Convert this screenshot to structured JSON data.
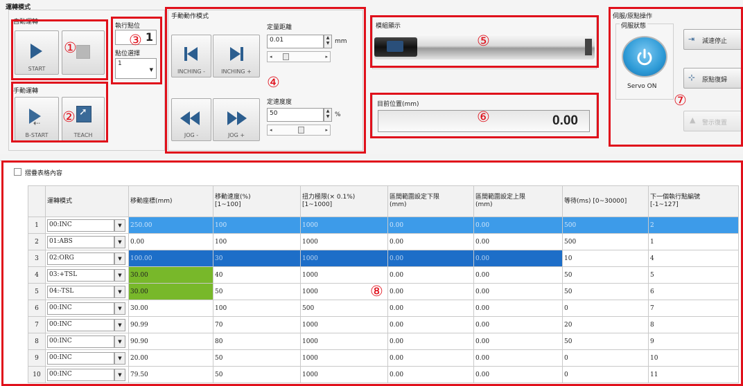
{
  "operation_mode": {
    "title": "運轉模式",
    "auto_title": "自動運轉",
    "start_label": "START",
    "manual_title": "手動運轉",
    "bstart_label": "B-START",
    "teach_label": "TEACH"
  },
  "exec_position": {
    "title": "執行點位",
    "value": "1",
    "select_label": "點位選擇",
    "select_value": "1"
  },
  "manual_motion": {
    "title": "手動動作模式",
    "distance_label": "定量距離",
    "distance_value": "0.01",
    "distance_unit": "mm",
    "speed_label": "定速度度",
    "speed_value": "50",
    "speed_unit": "%",
    "inching_minus": "INCHING -",
    "inching_plus": "INCHING +",
    "jog_minus": "JOG -",
    "jog_plus": "JOG +"
  },
  "model_display": {
    "title": "模組顯示"
  },
  "target_position": {
    "title": "目前位置(mm)",
    "value": "0.00"
  },
  "servo": {
    "title": "伺服/原點操作",
    "status_label": "伺服狀態",
    "servo_label": "Servo ON",
    "decel_stop": "減速停止",
    "home_return": "原點復歸",
    "alarm_reset": "警示復置",
    "accent": "#2d9ad6"
  },
  "table": {
    "fold_label": "摺疊表格內容",
    "headers": [
      "",
      "運轉模式",
      "移動座標(mm)",
      "移動速度(%)\n[1~100]",
      "扭力極限(× 0.1%)\n[1~1000]",
      "區間範圍設定下限\n(mm)",
      "區間範圍設定上限\n(mm)",
      "等待(ms) [0~30000]",
      "下一個執行點編號\n[-1~127]"
    ],
    "rows": [
      {
        "n": "1",
        "mode": "00:INC",
        "coord": "250.00",
        "speed": "100",
        "torque": "1000",
        "lo": "0.00",
        "hi": "0.00",
        "wait": "500",
        "next": "2"
      },
      {
        "n": "2",
        "mode": "01:ABS",
        "coord": "0.00",
        "speed": "100",
        "torque": "1000",
        "lo": "0.00",
        "hi": "0.00",
        "wait": "500",
        "next": "1"
      },
      {
        "n": "3",
        "mode": "02:ORG",
        "coord": "100.00",
        "speed": "30",
        "torque": "1000",
        "lo": "0.00",
        "hi": "0.00",
        "wait": "10",
        "next": "4"
      },
      {
        "n": "4",
        "mode": "03:+TSL",
        "coord": "30.00",
        "speed": "40",
        "torque": "1000",
        "lo": "0.00",
        "hi": "0.00",
        "wait": "50",
        "next": "5"
      },
      {
        "n": "5",
        "mode": "04:-TSL",
        "coord": "30.00",
        "speed": "50",
        "torque": "1000",
        "lo": "0.00",
        "hi": "0.00",
        "wait": "50",
        "next": "6"
      },
      {
        "n": "6",
        "mode": "00:INC",
        "coord": "30.00",
        "speed": "100",
        "torque": "500",
        "lo": "0.00",
        "hi": "0.00",
        "wait": "0",
        "next": "7"
      },
      {
        "n": "7",
        "mode": "00:INC",
        "coord": "90.99",
        "speed": "70",
        "torque": "1000",
        "lo": "0.00",
        "hi": "0.00",
        "wait": "20",
        "next": "8"
      },
      {
        "n": "8",
        "mode": "00:INC",
        "coord": "90.90",
        "speed": "80",
        "torque": "1000",
        "lo": "0.00",
        "hi": "0.00",
        "wait": "50",
        "next": "9"
      },
      {
        "n": "9",
        "mode": "00:INC",
        "coord": "20.00",
        "speed": "50",
        "torque": "1000",
        "lo": "0.00",
        "hi": "0.00",
        "wait": "0",
        "next": "10"
      },
      {
        "n": "10",
        "mode": "00:INC",
        "coord": "79.50",
        "speed": "50",
        "torque": "1000",
        "lo": "0.00",
        "hi": "0.00",
        "wait": "0",
        "next": "11"
      }
    ]
  },
  "annotations": [
    "①",
    "②",
    "③",
    "④",
    "⑤",
    "⑥",
    "⑦",
    "⑧"
  ],
  "colors": {
    "highlight_red": "#e0101b",
    "row_select_light": "#3d9be9",
    "row_select_dark": "#1d6ec8",
    "green_cell": "#78b82a",
    "icon_blue": "#2c5e8f"
  }
}
